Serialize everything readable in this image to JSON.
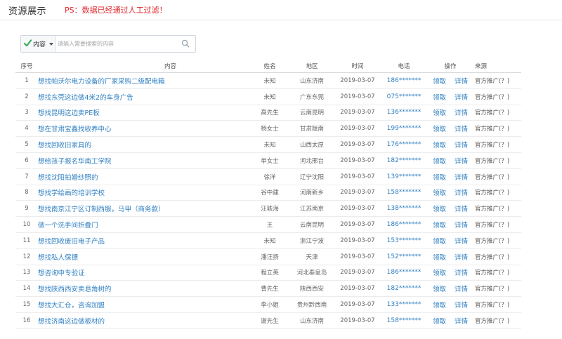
{
  "header": {
    "title": "资源展示",
    "notice": "PS：数据已经通过人工过滤！"
  },
  "search": {
    "category": "内容",
    "placeholder": "请输入需要搜索的内容"
  },
  "icons": {
    "check": "check-icon",
    "caret": "chevron-down-icon",
    "search": "search-icon"
  },
  "colors": {
    "accent": "#2f7fc1",
    "notice": "#e0262b",
    "check": "#34a853"
  },
  "table": {
    "columns": [
      "序号",
      "内容",
      "姓名",
      "地区",
      "时间",
      "电话",
      "操作",
      "来源"
    ],
    "action_claim": "领取",
    "action_detail": "详情",
    "rows": [
      {
        "no": "1",
        "content": "想找帕沃尔电力设备的厂家采购二级配电箱",
        "name": "未知",
        "region": "山东济南",
        "time": "2019-03-07",
        "phone": "186*******",
        "source": "官方推广(？)"
      },
      {
        "no": "2",
        "content": "想找东莞这边做4米2的车身广告",
        "name": "未知",
        "region": "广东东莞",
        "time": "2019-03-07",
        "phone": "075*******",
        "source": "官方推广(？)"
      },
      {
        "no": "3",
        "content": "想找昆明这边卖PE板",
        "name": "高先生",
        "region": "云南昆明",
        "time": "2019-03-07",
        "phone": "136*******",
        "source": "官方推广(？)"
      },
      {
        "no": "4",
        "content": "想在甘肃宝鑫找收养中心",
        "name": "杨女士",
        "region": "甘肃陇南",
        "time": "2019-03-07",
        "phone": "199*******",
        "source": "官方推广(？)"
      },
      {
        "no": "5",
        "content": "想找回收旧家具的",
        "name": "未知",
        "region": "山西太原",
        "time": "2019-03-07",
        "phone": "176*******",
        "source": "官方推广(？)"
      },
      {
        "no": "6",
        "content": "想给孩子报名华南工学院",
        "name": "单女士",
        "region": "河北邢台",
        "time": "2019-03-07",
        "phone": "182*******",
        "source": "官方推广(？)"
      },
      {
        "no": "7",
        "content": "想找沈阳拍婚纱照的",
        "name": "徐洋",
        "region": "辽宁沈阳",
        "time": "2019-03-07",
        "phone": "139*******",
        "source": "官方推广(？)"
      },
      {
        "no": "8",
        "content": "想找学绘画的培训学校",
        "name": "谷中建",
        "region": "河南新乡",
        "time": "2019-03-07",
        "phone": "158*******",
        "source": "官方推广(？)"
      },
      {
        "no": "9",
        "content": "想找南京江宁区订制西服，马甲（商务款）",
        "name": "汪轶海",
        "region": "江苏南京",
        "time": "2019-03-07",
        "phone": "138*******",
        "source": "官方推广(？)"
      },
      {
        "no": "10",
        "content": "做一个洗手间折叠门",
        "name": "王",
        "region": "云南昆明",
        "time": "2019-03-07",
        "phone": "186*******",
        "source": "官方推广(？)"
      },
      {
        "no": "11",
        "content": "想找回收废旧电子产品",
        "name": "未知",
        "region": "浙江宁波",
        "time": "2019-03-07",
        "phone": "153*******",
        "source": "官方推广(？)"
      },
      {
        "no": "12",
        "content": "想找私人保镖",
        "name": "潘汪扬",
        "region": "天津",
        "time": "2019-03-07",
        "phone": "152*******",
        "source": "官方推广(？)"
      },
      {
        "no": "13",
        "content": "想咨询中专验证",
        "name": "程立英",
        "region": "河北秦皇岛",
        "time": "2019-03-07",
        "phone": "186*******",
        "source": "官方推广(？)"
      },
      {
        "no": "14",
        "content": "想找陕西西安卖皂角树的",
        "name": "曹先生",
        "region": "陕西西安",
        "time": "2019-03-07",
        "phone": "182*******",
        "source": "官方推广(？)"
      },
      {
        "no": "15",
        "content": "想找大汇仓，咨询加盟",
        "name": "李小姐",
        "region": "贵州黔西南",
        "time": "2019-03-07",
        "phone": "133*******",
        "source": "官方推广(？)"
      },
      {
        "no": "16",
        "content": "想找济南这边做板材的",
        "name": "谢先生",
        "region": "山东济南",
        "time": "2019-03-07",
        "phone": "158*******",
        "source": "官方推广(？)"
      }
    ]
  }
}
